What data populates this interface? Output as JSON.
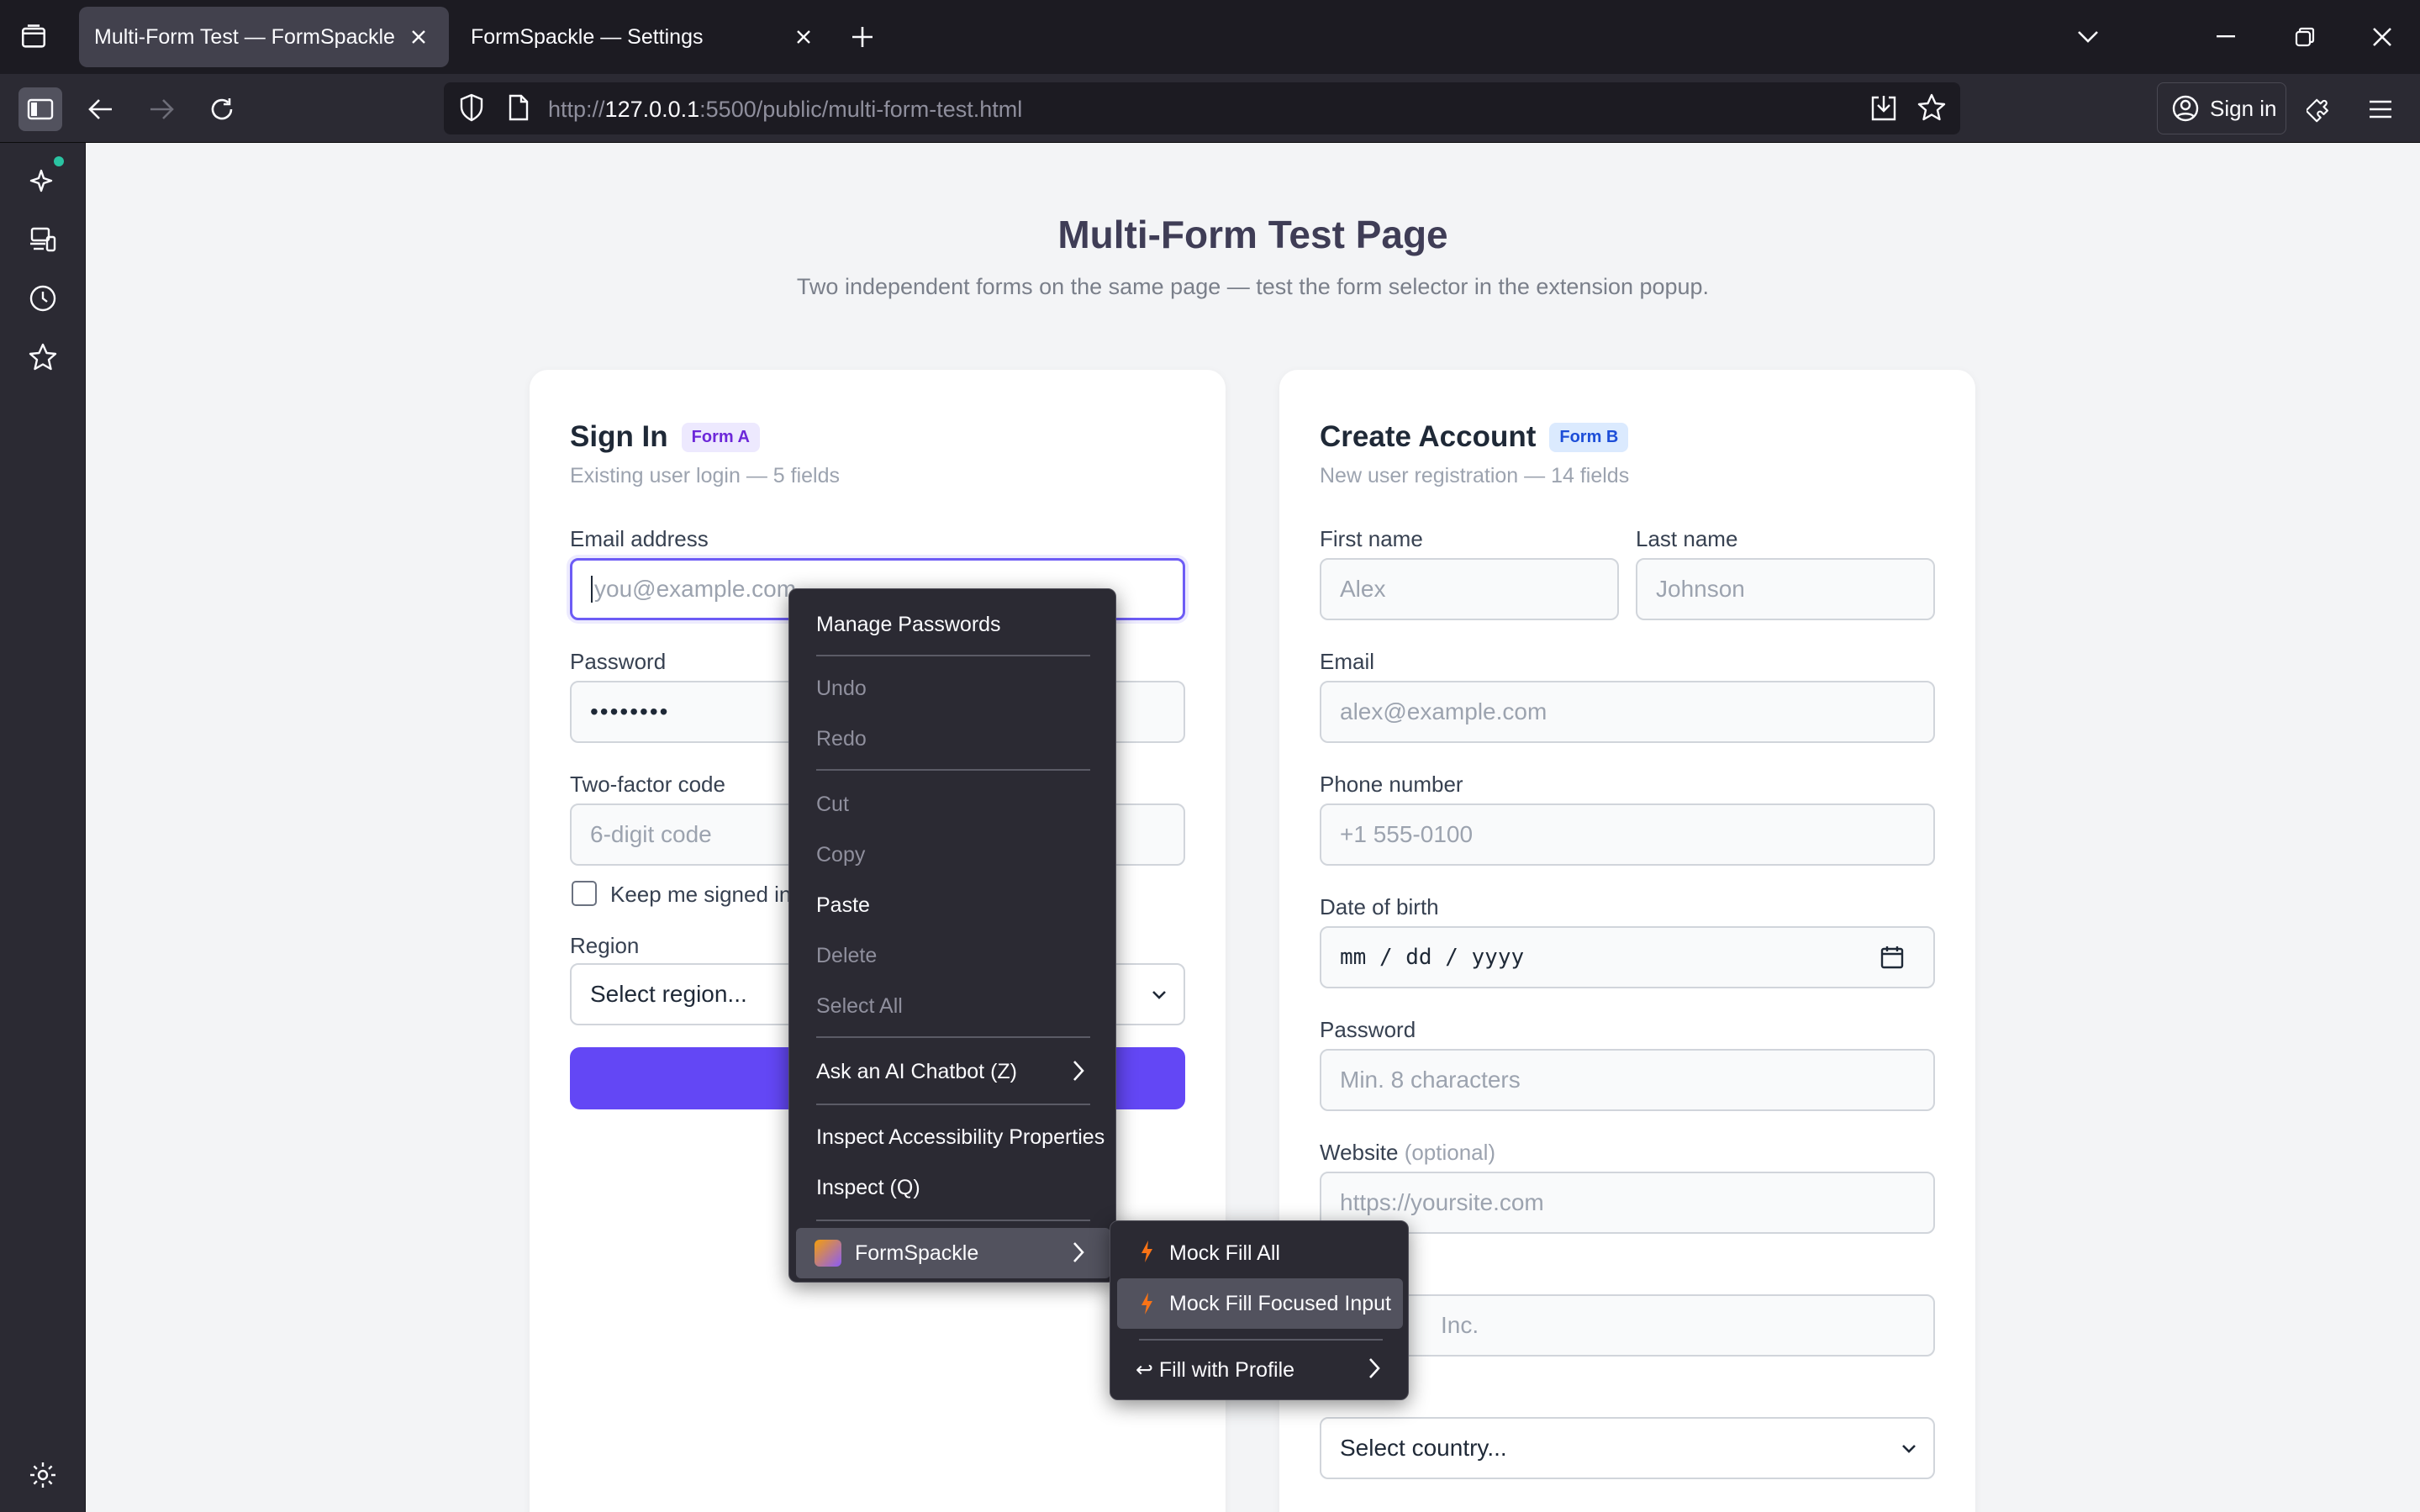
{
  "browser": {
    "tabs": [
      {
        "title": "Multi-Form Test — FormSpackle",
        "active": true
      },
      {
        "title": "FormSpackle — Settings",
        "active": false
      }
    ],
    "url": {
      "scheme": "http://",
      "host": "127.0.0.1",
      "rest": ":5500/public/multi-form-test.html"
    },
    "sign_in_label": "Sign in"
  },
  "page": {
    "title": "Multi-Form Test Page",
    "subtitle": "Two independent forms on the same page — test the form selector in the extension popup."
  },
  "form_a": {
    "title": "Sign In",
    "badge": "Form A",
    "subtitle": "Existing user login — 5 fields",
    "email_label": "Email address",
    "email_placeholder": "you@example.com",
    "password_label": "Password",
    "password_value": "••••••••",
    "twofa_label": "Two-factor code",
    "twofa_placeholder": "6-digit code",
    "keep_signed_label": "Keep me signed in",
    "region_label": "Region",
    "region_value": "Select region..."
  },
  "form_b": {
    "title": "Create Account",
    "badge": "Form B",
    "subtitle": "New user registration — 14 fields",
    "first_name_label": "First name",
    "first_name_placeholder": "Alex",
    "last_name_label": "Last name",
    "last_name_placeholder": "Johnson",
    "email_label": "Email",
    "email_placeholder": "alex@example.com",
    "phone_label": "Phone number",
    "phone_placeholder": "+1 555-0100",
    "dob_label": "Date of birth",
    "dob_value": "mm / dd / yyyy",
    "password_label": "Password",
    "password_placeholder": "Min. 8 characters",
    "website_label": "Website",
    "website_optional": "(optional)",
    "website_placeholder": "https://yoursite.com",
    "company_placeholder_visible": "Inc.",
    "country_value": "Select country..."
  },
  "context_menu": {
    "items": [
      {
        "label": "Manage Passwords",
        "enabled": true
      },
      {
        "label": "Undo",
        "enabled": false
      },
      {
        "label": "Redo",
        "enabled": false
      },
      {
        "label": "Cut",
        "enabled": false
      },
      {
        "label": "Copy",
        "enabled": false
      },
      {
        "label": "Paste",
        "enabled": true
      },
      {
        "label": "Delete",
        "enabled": false
      },
      {
        "label": "Select All",
        "enabled": false
      },
      {
        "label": "Ask an AI Chatbot (Z)",
        "enabled": true
      },
      {
        "label": "Inspect Accessibility Properties",
        "enabled": true
      },
      {
        "label": "Inspect (Q)",
        "enabled": true
      },
      {
        "label": "FormSpackle",
        "enabled": true
      }
    ],
    "submenu": [
      {
        "label": "Mock Fill All"
      },
      {
        "label": "Mock Fill Focused Input"
      },
      {
        "label": "↩ Fill with Profile"
      }
    ]
  },
  "colors": {
    "accent": "#6347f5",
    "chrome_dark": "#1c1b22",
    "chrome": "#2b2a33",
    "page_bg": "#f3f4f6",
    "bolt": "#f97316"
  }
}
